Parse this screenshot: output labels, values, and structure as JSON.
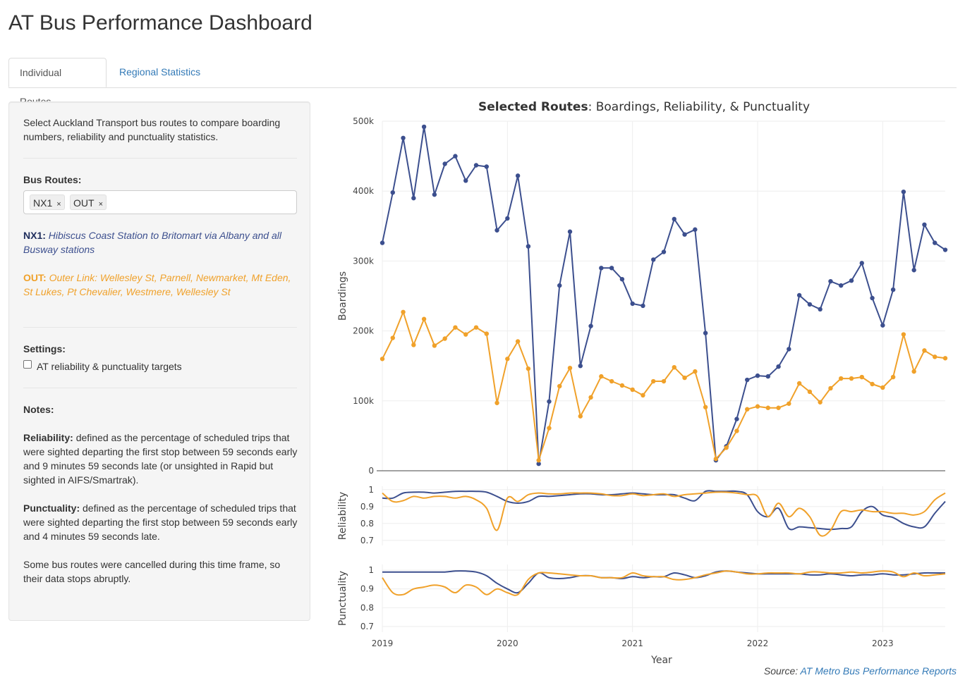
{
  "app": {
    "title": "AT Bus Performance Dashboard"
  },
  "tabs": [
    {
      "label": "Individual Routes"
    },
    {
      "label": "Regional Statistics"
    }
  ],
  "sidebar": {
    "intro": "Select Auckland Transport bus routes to compare boarding numbers, reliability and punctuality statistics.",
    "routes_label": "Bus Routes:",
    "selected_routes": [
      {
        "label": "NX1",
        "remove": "×"
      },
      {
        "label": "OUT",
        "remove": "×"
      }
    ],
    "route_descriptions": [
      {
        "code": "NX1:",
        "text": "Hibiscus Coast Station to Britomart via Albany and all Busway stations",
        "color": "#3c4f8e"
      },
      {
        "code": "OUT:",
        "text": "Outer Link: Wellesley St, Parnell, Newmarket, Mt Eden, St Lukes, Pt Chevalier, Westmere, Wellesley St",
        "color": "#f0a12a"
      }
    ],
    "settings_label": "Settings:",
    "targets_checkbox": {
      "label": "AT reliability & punctuality targets",
      "checked": false
    },
    "notes_label": "Notes:",
    "reliability_term": "Reliability:",
    "reliability_text": "defined as the percentage of scheduled trips that were sighted departing the first stop between 59 seconds early and 9 minutes 59 seconds late (or unsighted in Rapid but sighted in AIFS/Smartrak).",
    "punctuality_term": "Punctuality:",
    "punctuality_text": "defined as the percentage of scheduled trips that were sighted departing the first stop between 59 seconds early and 4 minutes 59 seconds late.",
    "cancel_note": "Some bus routes were cancelled during this time frame, so their data stops abruptly."
  },
  "source": {
    "prefix": "Source:",
    "link": "AT Metro Bus Performance Reports"
  },
  "chart_data": {
    "type": "line",
    "title_bold": "Selected Routes",
    "title_rest": ": Boardings, Reliability, & Punctuality",
    "xlabel": "Year",
    "x_ticks": [
      "2019",
      "2020",
      "2021",
      "2022",
      "2023"
    ],
    "x_start": "2019-01",
    "x_end": "2023-07",
    "colors": {
      "NX1": "#3c4f8e",
      "OUT": "#f0a12a"
    },
    "months": [
      "2019-01",
      "2019-02",
      "2019-03",
      "2019-04",
      "2019-05",
      "2019-06",
      "2019-07",
      "2019-08",
      "2019-09",
      "2019-10",
      "2019-11",
      "2019-12",
      "2020-01",
      "2020-02",
      "2020-03",
      "2020-04",
      "2020-05",
      "2020-06",
      "2020-07",
      "2020-08",
      "2020-09",
      "2020-10",
      "2020-11",
      "2020-12",
      "2021-01",
      "2021-02",
      "2021-03",
      "2021-04",
      "2021-05",
      "2021-06",
      "2021-07",
      "2021-08",
      "2021-09",
      "2021-10",
      "2021-11",
      "2021-12",
      "2022-01",
      "2022-02",
      "2022-03",
      "2022-04",
      "2022-05",
      "2022-06",
      "2022-07",
      "2022-08",
      "2022-09",
      "2022-10",
      "2022-11",
      "2022-12",
      "2023-01",
      "2023-02",
      "2023-03",
      "2023-04",
      "2023-05",
      "2023-06",
      "2023-07"
    ],
    "boardings": {
      "ylabel": "Boardings",
      "ylim": [
        0,
        500000
      ],
      "y_ticks": [
        0,
        100000,
        200000,
        300000,
        400000,
        500000
      ],
      "y_tick_labels": [
        "0",
        "100k",
        "200k",
        "300k",
        "400k",
        "500k"
      ],
      "series": [
        {
          "name": "NX1",
          "values": [
            326000,
            398000,
            476000,
            390000,
            492000,
            395000,
            439000,
            450000,
            415000,
            437000,
            435000,
            344000,
            361000,
            422000,
            321000,
            10000,
            99000,
            265000,
            342000,
            150000,
            207000,
            290000,
            290000,
            274000,
            239000,
            236000,
            302000,
            313000,
            360000,
            338000,
            345000,
            197000,
            15000,
            35000,
            74000,
            130000,
            136000,
            135000,
            149000,
            174000,
            251000,
            238000,
            231000,
            271000,
            265000,
            272000,
            297000,
            247000,
            208000,
            259000,
            399000,
            287000,
            352000,
            326000,
            316000
          ]
        },
        {
          "name": "OUT",
          "values": [
            160000,
            190000,
            227000,
            180000,
            217000,
            179000,
            189000,
            205000,
            195000,
            205000,
            196000,
            97000,
            160000,
            185000,
            146000,
            15000,
            61000,
            121000,
            147000,
            78000,
            105000,
            135000,
            128000,
            122000,
            116000,
            108000,
            128000,
            128000,
            148000,
            133000,
            142000,
            91000,
            17000,
            33000,
            57000,
            88000,
            92000,
            90000,
            90000,
            96000,
            125000,
            113000,
            98000,
            118000,
            132000,
            132000,
            134000,
            124000,
            119000,
            134000,
            195000,
            142000,
            172000,
            163000,
            161000
          ]
        }
      ]
    },
    "reliability": {
      "ylabel": "Reliability",
      "ylim": [
        0.67,
        1.02
      ],
      "y_ticks": [
        0.7,
        0.8,
        0.9,
        1
      ],
      "y_tick_labels": [
        "0.7",
        "0.8",
        "0.9",
        "1"
      ],
      "series": [
        {
          "name": "NX1",
          "values": [
            0.95,
            0.95,
            0.98,
            0.985,
            0.985,
            0.98,
            0.985,
            0.99,
            0.99,
            0.99,
            0.985,
            0.96,
            0.93,
            0.92,
            0.93,
            0.96,
            0.96,
            0.965,
            0.97,
            0.975,
            0.975,
            0.97,
            0.97,
            0.975,
            0.98,
            0.975,
            0.97,
            0.97,
            0.97,
            0.95,
            0.935,
            0.99,
            0.99,
            0.99,
            0.99,
            0.97,
            0.87,
            0.84,
            0.89,
            0.77,
            0.78,
            0.775,
            0.77,
            0.765,
            0.77,
            0.78,
            0.87,
            0.9,
            0.85,
            0.835,
            0.8,
            0.78,
            0.78,
            0.86,
            0.93
          ]
        },
        {
          "name": "OUT",
          "values": [
            0.98,
            0.93,
            0.935,
            0.96,
            0.95,
            0.96,
            0.96,
            0.95,
            0.96,
            0.94,
            0.89,
            0.76,
            0.95,
            0.93,
            0.97,
            0.98,
            0.975,
            0.975,
            0.98,
            0.98,
            0.98,
            0.975,
            0.965,
            0.965,
            0.975,
            0.965,
            0.97,
            0.975,
            0.96,
            0.97,
            0.975,
            0.98,
            0.985,
            0.985,
            0.98,
            0.97,
            0.96,
            0.84,
            0.92,
            0.84,
            0.89,
            0.84,
            0.73,
            0.76,
            0.87,
            0.87,
            0.88,
            0.87,
            0.87,
            0.86,
            0.86,
            0.85,
            0.87,
            0.94,
            0.98
          ]
        }
      ]
    },
    "punctuality": {
      "ylabel": "Punctuality",
      "ylim": [
        0.67,
        1.03
      ],
      "y_ticks": [
        0.7,
        0.8,
        0.9,
        1
      ],
      "y_tick_labels": [
        "0.7",
        "0.8",
        "0.9",
        "1"
      ],
      "series": [
        {
          "name": "NX1",
          "values": [
            0.99,
            0.99,
            0.99,
            0.99,
            0.99,
            0.99,
            0.99,
            0.995,
            0.995,
            0.99,
            0.97,
            0.93,
            0.9,
            0.88,
            0.93,
            0.985,
            0.96,
            0.955,
            0.96,
            0.97,
            0.97,
            0.96,
            0.96,
            0.955,
            0.965,
            0.96,
            0.965,
            0.965,
            0.985,
            0.975,
            0.96,
            0.97,
            0.99,
            0.995,
            0.99,
            0.985,
            0.98,
            0.98,
            0.98,
            0.98,
            0.98,
            0.975,
            0.975,
            0.98,
            0.975,
            0.97,
            0.975,
            0.975,
            0.98,
            0.975,
            0.975,
            0.98,
            0.985,
            0.985,
            0.985
          ]
        },
        {
          "name": "OUT",
          "values": [
            0.96,
            0.88,
            0.87,
            0.9,
            0.91,
            0.92,
            0.91,
            0.88,
            0.92,
            0.91,
            0.87,
            0.9,
            0.88,
            0.87,
            0.95,
            0.985,
            0.985,
            0.98,
            0.975,
            0.97,
            0.97,
            0.96,
            0.96,
            0.96,
            0.985,
            0.97,
            0.965,
            0.965,
            0.95,
            0.95,
            0.96,
            0.975,
            0.985,
            0.995,
            0.99,
            0.98,
            0.98,
            0.985,
            0.985,
            0.985,
            0.98,
            0.99,
            0.99,
            0.985,
            0.985,
            0.99,
            0.985,
            0.99,
            0.995,
            0.99,
            0.965,
            0.985,
            0.97,
            0.975,
            0.98
          ]
        }
      ]
    }
  }
}
